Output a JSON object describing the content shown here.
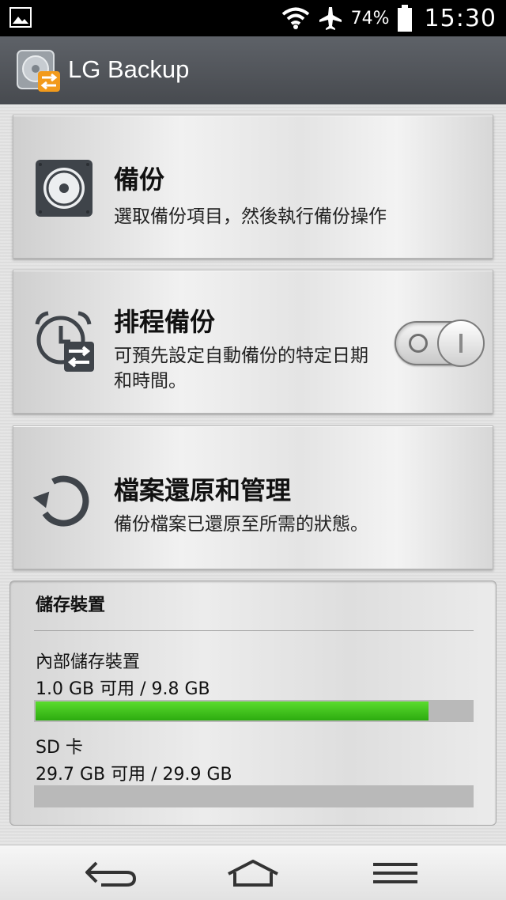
{
  "status_bar": {
    "battery_percent": "74%",
    "time": "15:30"
  },
  "app_bar": {
    "title": "LG Backup"
  },
  "cards": {
    "backup": {
      "title": "備份",
      "description": "選取備份項目，然後執行備份操作"
    },
    "schedule": {
      "title": "排程備份",
      "description": "可預先設定自動備份的特定日期和時間。",
      "enabled": false
    },
    "restore": {
      "title": "檔案還原和管理",
      "description": "備份檔案已還原至所需的狀態。"
    }
  },
  "storage": {
    "title": "儲存裝置",
    "internal": {
      "name": "內部儲存裝置",
      "usage": "1.0 GB 可用 / 9.8 GB",
      "used_fraction": 0.9
    },
    "sd": {
      "name": "SD 卡",
      "usage": "29.7 GB 可用 / 29.9 GB",
      "used_fraction": 0.0
    }
  },
  "colors": {
    "usage_bar": "#3cc51e",
    "app_bar": "#53575c"
  }
}
